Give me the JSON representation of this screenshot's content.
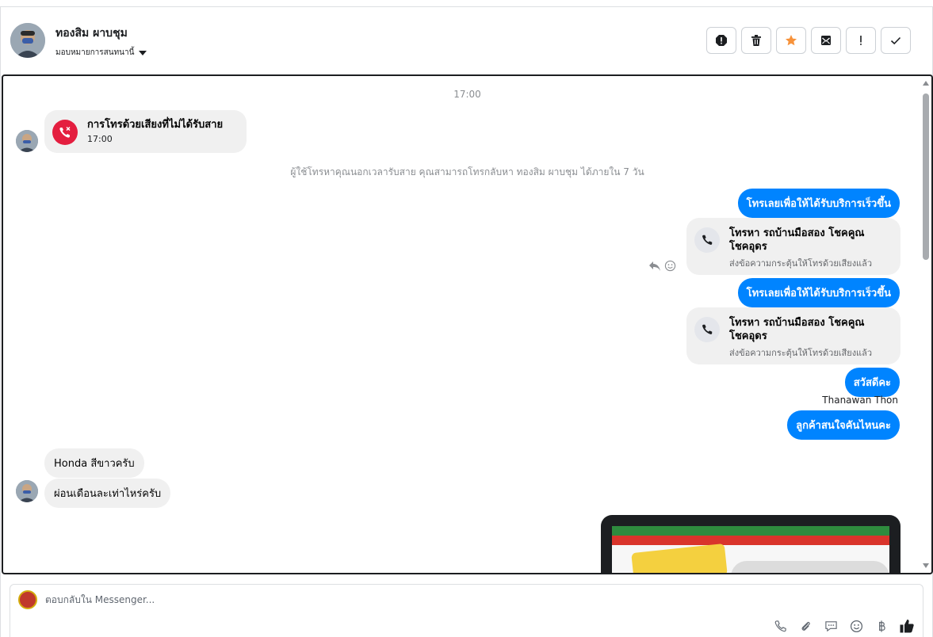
{
  "header": {
    "contact_name": "ทองสิม ผาบชุม",
    "assign_label": "มอบหมายการสนทนานี้"
  },
  "conversation": {
    "timestamp": "17:00",
    "missed_call": {
      "title": "การโทรด้วยเสียงที่ไม่ได้รับสาย",
      "time": "17:00"
    },
    "notice": "ผู้ใช้โทรหาคุณนอกเวลารับสาย คุณสามารถโทรกลับหา ทองสิม ผาบชุม ได้ภายใน 7 วัน",
    "cta_1": "โทรเลยเพื่อให้ได้รับบริการเร็วขึ้น",
    "call_card_1": {
      "title_line1": "โทรหา รถบ้านมือสอง โชคคูณ",
      "title_line2": "โชคอุดร",
      "subtitle": "ส่งข้อความกระตุ้นให้โทรด้วยเสียงแล้ว"
    },
    "cta_2": "โทรเลยเพื่อให้ได้รับบริการเร็วขึ้น",
    "call_card_2": {
      "title_line1": "โทรหา รถบ้านมือสอง โชคคูณ",
      "title_line2": "โชคอุดร",
      "subtitle": "ส่งข้อความกระตุ้นให้โทรด้วยเสียงแล้ว"
    },
    "greeting": "สวัสดีคะ",
    "sender_name": "Thanawan Thon",
    "question": "ลูกค้าสนใจคันไหนคะ",
    "reply_1": "Honda สีขาวครับ",
    "reply_2": "ผ่อนเดือนละเท่าไหร่ครับ"
  },
  "composer": {
    "placeholder": "ตอบกลับใน Messenger..."
  },
  "colors": {
    "accent": "#0084ff",
    "missed": "#e41e3f",
    "star": "#f7923a"
  }
}
